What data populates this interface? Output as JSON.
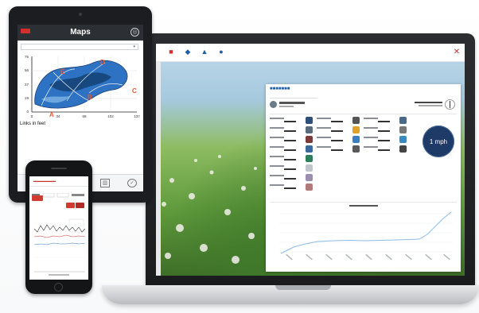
{
  "tablet": {
    "title": "Maps",
    "links_label": "Links in feet",
    "globe_icon": "globe-icon",
    "map": {
      "y_ticks": [
        "75",
        "56",
        "37",
        "19",
        "0"
      ],
      "x_ticks": [
        "0",
        "34",
        "68",
        "102",
        "137"
      ],
      "point_labels": [
        "A",
        "B",
        "C",
        "D",
        "E"
      ],
      "label_color": "#e8572a"
    }
  },
  "laptop": {
    "wind_value": "1 mph",
    "panel_accent": "#1e5fa8",
    "dial_color": "#1d3b66"
  },
  "phone": {
    "accent": "#d23b33"
  }
}
